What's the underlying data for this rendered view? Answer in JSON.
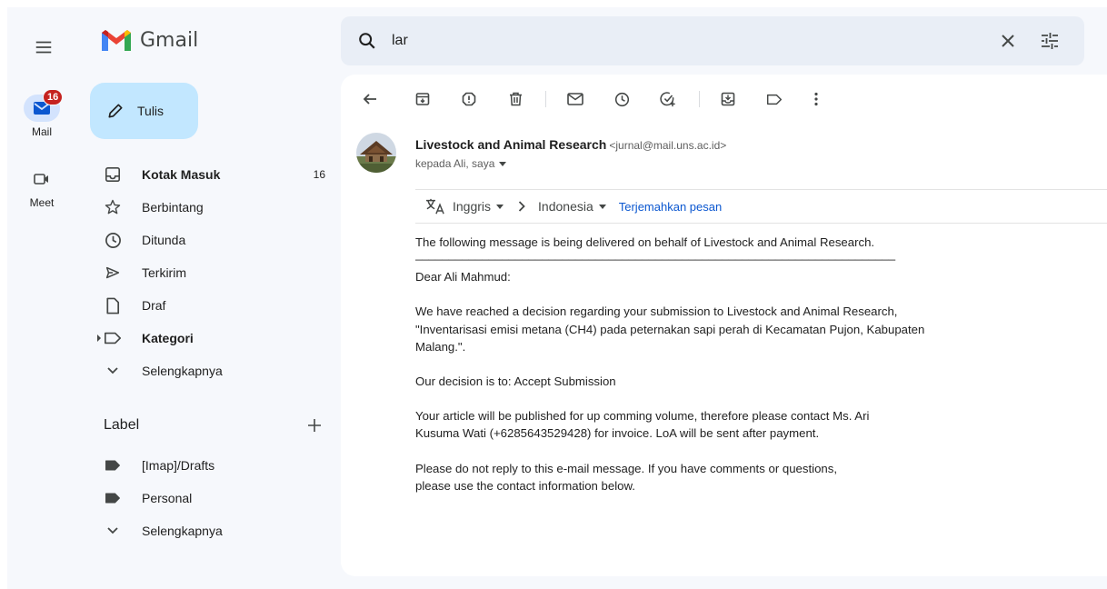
{
  "app": {
    "name": "Gmail"
  },
  "rail": {
    "mail": {
      "label": "Mail",
      "badge": "16"
    },
    "meet": {
      "label": "Meet"
    }
  },
  "compose": {
    "label": "Tulis"
  },
  "nav": [
    {
      "label": "Kotak Masuk",
      "count": "16",
      "icon": "inbox-icon",
      "bold": true
    },
    {
      "label": "Berbintang",
      "icon": "star-icon"
    },
    {
      "label": "Ditunda",
      "icon": "clock-icon"
    },
    {
      "label": "Terkirim",
      "icon": "send-icon"
    },
    {
      "label": "Draf",
      "icon": "file-icon"
    },
    {
      "label": "Kategori",
      "icon": "label-icon",
      "bold": true
    },
    {
      "label": "Selengkapnya",
      "icon": "chevron-down-icon"
    }
  ],
  "labels": {
    "title": "Label",
    "items": [
      {
        "label": "[Imap]/Drafts"
      },
      {
        "label": "Personal"
      },
      {
        "label": "Selengkapnya"
      }
    ]
  },
  "search": {
    "value": "lar"
  },
  "email": {
    "sender_name": "Livestock and Animal Research",
    "sender_email": "<jurnal@mail.uns.ac.id>",
    "recipient": "kepada Ali, saya",
    "translate": {
      "from": "Inggris",
      "to": "Indonesia",
      "action": "Terjemahkan pesan"
    },
    "body": {
      "intro": "The following message is being delivered on behalf of Livestock and Animal Research.",
      "rule": "________________________________________________________________________",
      "greeting": "Dear Ali Mahmud:",
      "p1": "We have reached a decision regarding your submission to Livestock and Animal Research, \"Inventarisasi emisi metana (CH4) pada peternakan sapi perah di Kecamatan Pujon, Kabupaten Malang.\".",
      "p2": "Our decision is to: Accept Submission",
      "p3": "Your article will be published for up comming volume, therefore please contact Ms. Ari Kusuma Wati (+6285643529428) for invoice. LoA will be sent after payment.",
      "p4": "Please do not reply to this e-mail message. If you have comments or questions, please use the contact information below."
    }
  },
  "colors": {
    "background": "#f6f8fc",
    "compose": "#c2e7ff",
    "search": "#e9eef6",
    "badge": "#c5221f",
    "link": "#0b57d0"
  }
}
